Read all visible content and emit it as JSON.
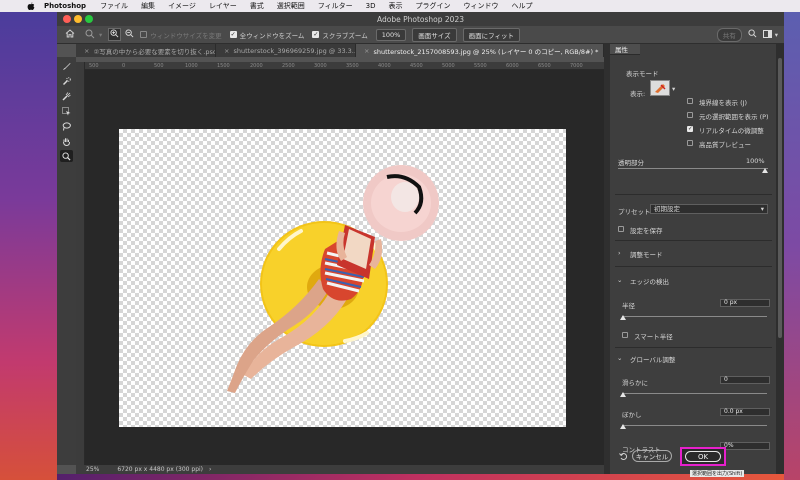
{
  "menubar": {
    "app_name": "Photoshop",
    "items": [
      "ファイル",
      "編集",
      "イメージ",
      "レイヤー",
      "書式",
      "選択範囲",
      "フィルター",
      "3D",
      "表示",
      "プラグイン",
      "ウィンドウ",
      "ヘルプ"
    ]
  },
  "window": {
    "title": "Adobe Photoshop 2023"
  },
  "options": {
    "resize_windows_label": "ウィンドウサイズを変更",
    "zoom_all_label": "全ウィンドウをズーム",
    "scrubby_zoom_label": "スクラブズーム",
    "zoom_value": "100%",
    "fit_screen_label": "画面サイズ",
    "fill_screen_label": "画面にフィット",
    "share_label": "共有"
  },
  "tabs": [
    {
      "label": "②写真の中から必要な要素を切り抜く.psd",
      "active": false
    },
    {
      "label": "shutterstock_396969259.jpg @ 33.3...",
      "active": false
    },
    {
      "label": "shutterstock_2157008593.jpg @ 25% (レイヤー 0 のコピー, RGB/8#) *",
      "active": true
    }
  ],
  "ruler_labels": [
    "500",
    "0",
    "500",
    "1000",
    "1500",
    "2000",
    "2500",
    "3000",
    "3500",
    "4000",
    "4500",
    "5000",
    "5500",
    "6000",
    "6500",
    "7000"
  ],
  "status": {
    "zoom": "25%",
    "doc_info": "6720 px x 4480 px (300 ppi)"
  },
  "panel": {
    "tab": "属性",
    "view_mode_heading": "表示モード",
    "view_label": "表示:",
    "show_edge_label": "境界線を表示 (J)",
    "show_original_label": "元の選択範囲を表示 (P)",
    "realtime_refine_label": "リアルタイムの微調整",
    "hq_preview_label": "高品質プレビュー",
    "opacity_label": "透明部分",
    "opacity_value": "100%",
    "preset_label": "プリセット",
    "preset_value": "初期設定",
    "remember_label": "設定を保存",
    "adjust_mode_label": "調整モード",
    "edge_detect_label": "エッジの検出",
    "radius_label": "半径",
    "radius_value": "0 px",
    "smart_radius_label": "スマート半径",
    "global_adjust_label": "グローバル調整",
    "smooth_label": "滑らかに",
    "smooth_value": "0",
    "feather_label": "ぼかし",
    "feather_value": "0.0 px",
    "contrast_label": "コントラスト",
    "contrast_value": "0%",
    "cancel_label": "キャンセル",
    "ok_label": "OK",
    "ok_caption": "選択範囲を出力(Shift)"
  },
  "colors": {
    "highlight": "#e620cc",
    "checker": "#d6d6d6",
    "float_ring": "#f3c417",
    "hat": "#f0c9c6"
  }
}
